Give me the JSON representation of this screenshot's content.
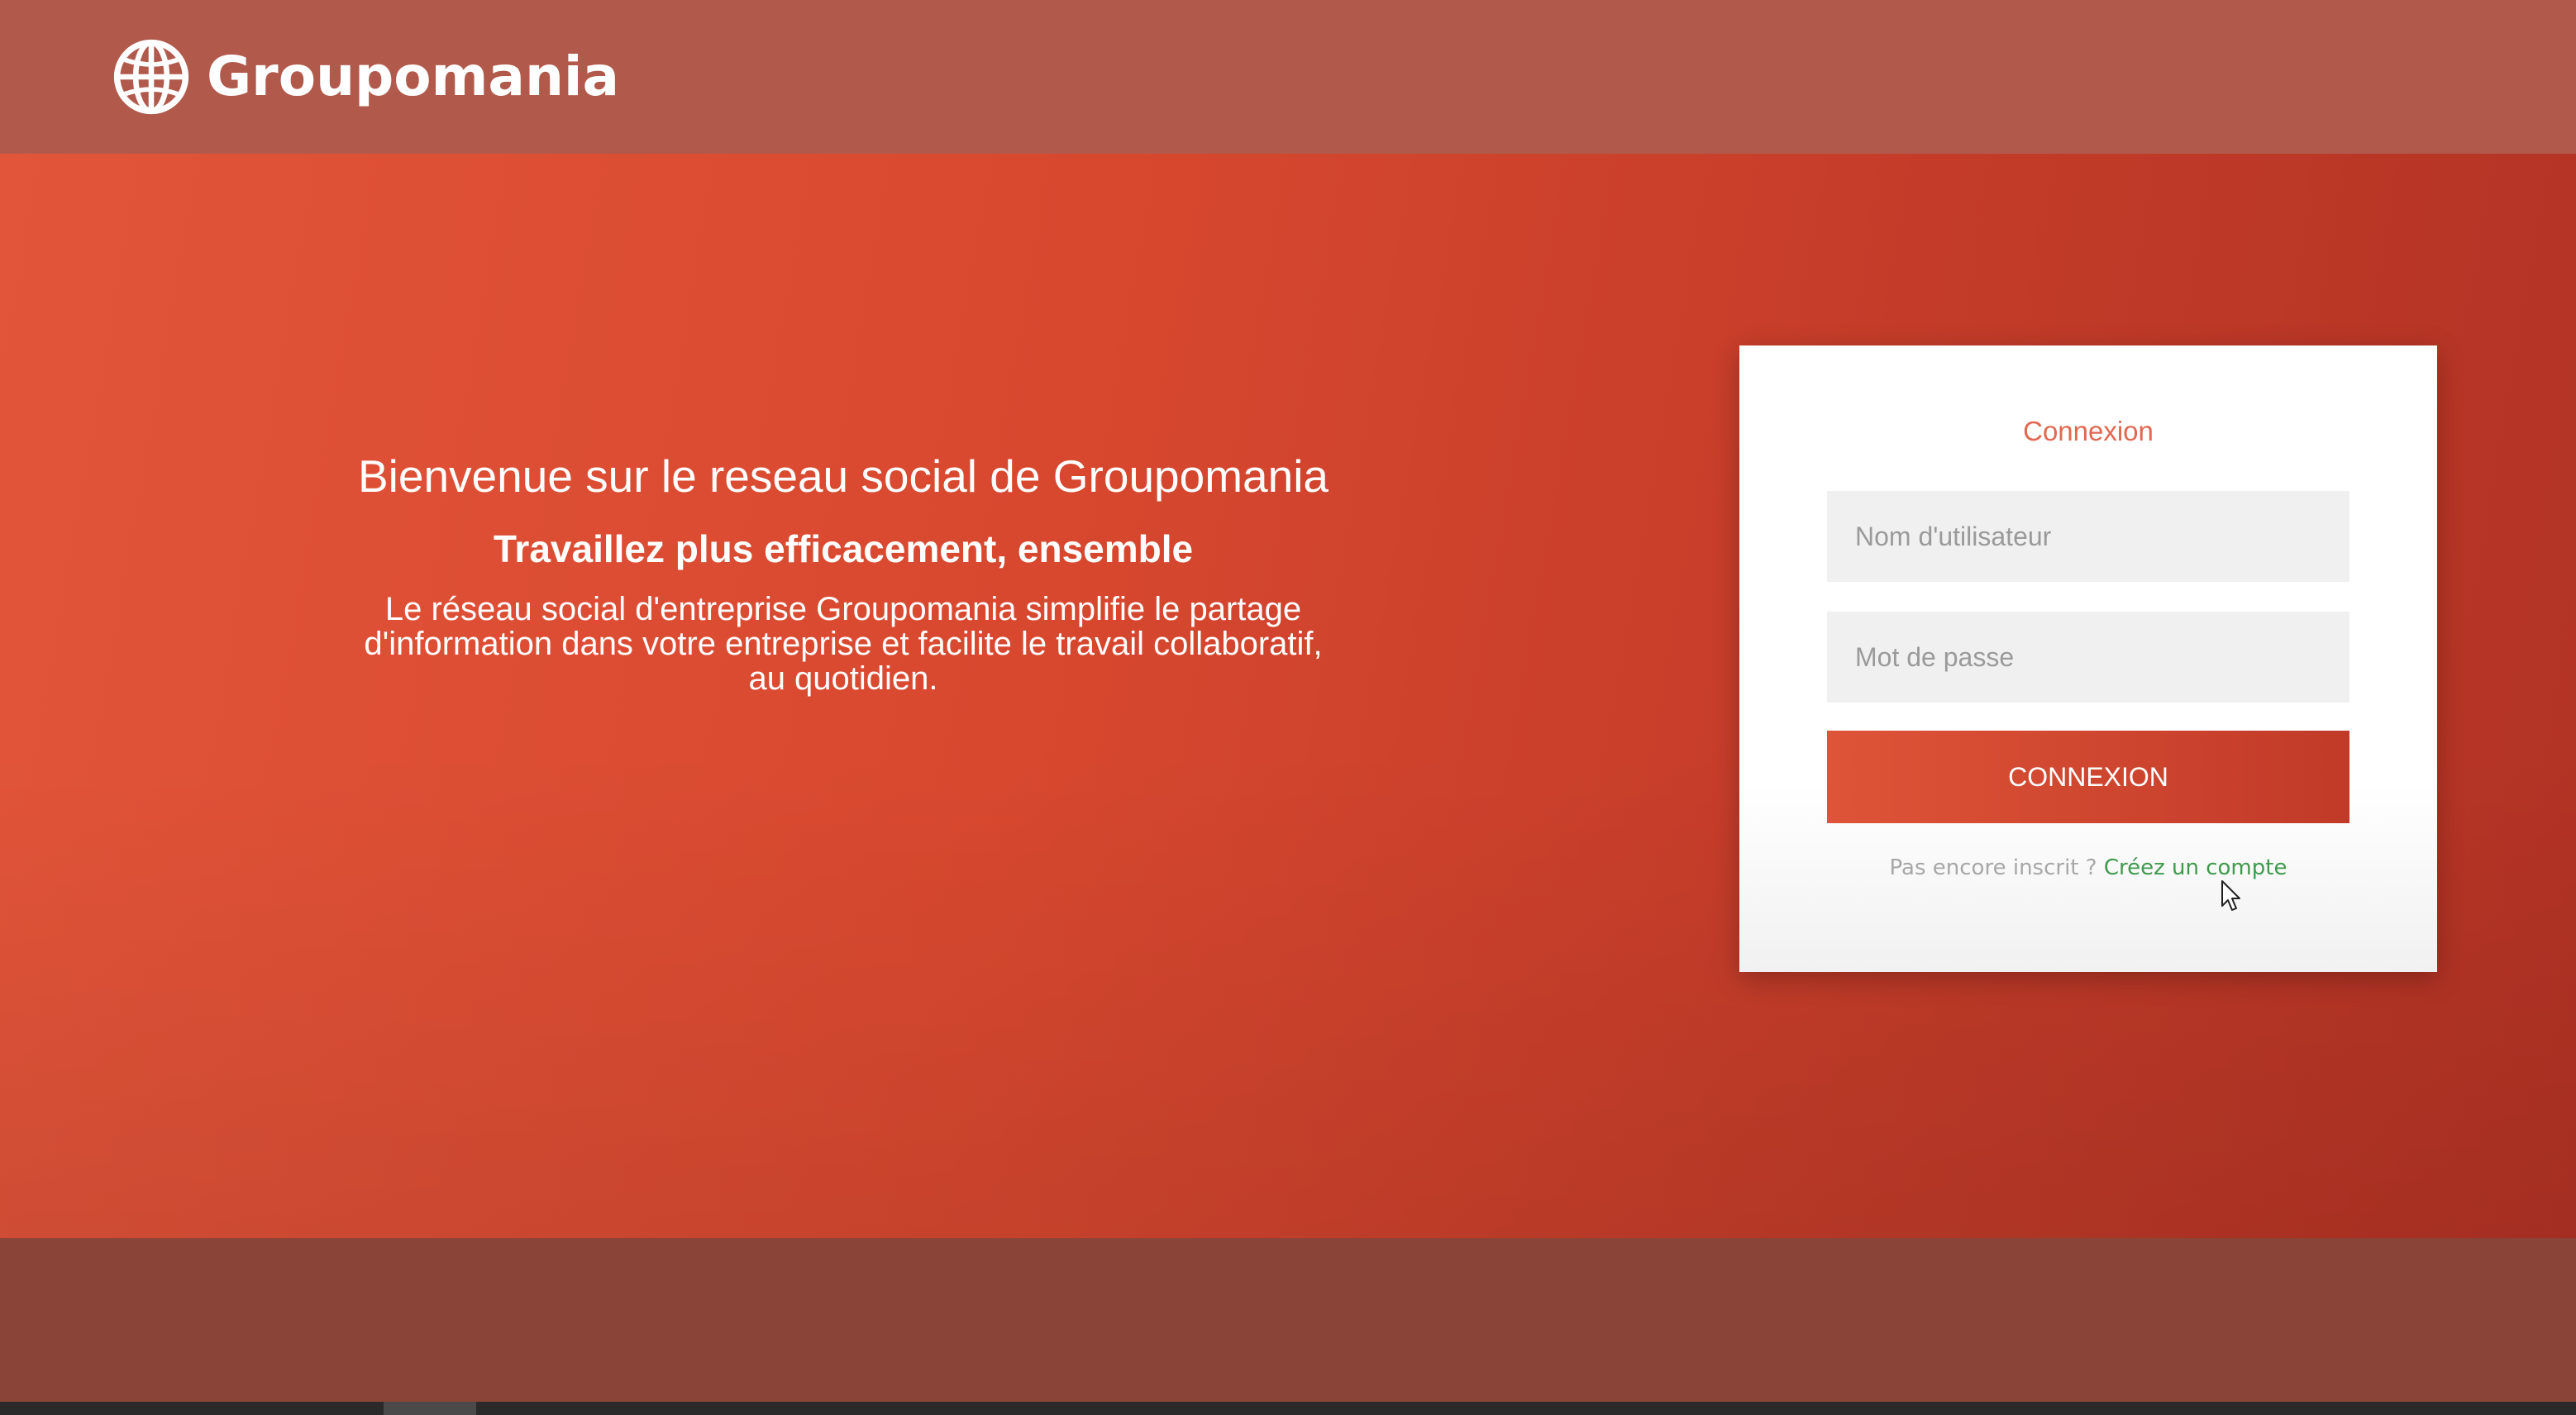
{
  "header": {
    "logo_icon": "globe-icon",
    "brand": "Groupomania"
  },
  "intro": {
    "title": "Bienvenue sur le reseau social de Groupomania",
    "subtitle": "Travaillez plus efficacement, ensemble",
    "description": "Le réseau social d'entreprise Groupomania simplifie le partage d'information dans votre entreprise et facilite le travail collaboratif, au quotidien."
  },
  "login": {
    "title": "Connexion",
    "username_placeholder": "Nom d'utilisateur",
    "password_placeholder": "Mot de passe",
    "submit_label": "CONNEXION",
    "signup_prompt": "Pas encore inscrit ? ",
    "signup_link": "Créez un compte"
  },
  "colors": {
    "header": "#b15a4c",
    "accent": "#d8482f",
    "title_accent": "#e2684f",
    "link": "#3f9a4c",
    "footer": "#8b4438"
  }
}
